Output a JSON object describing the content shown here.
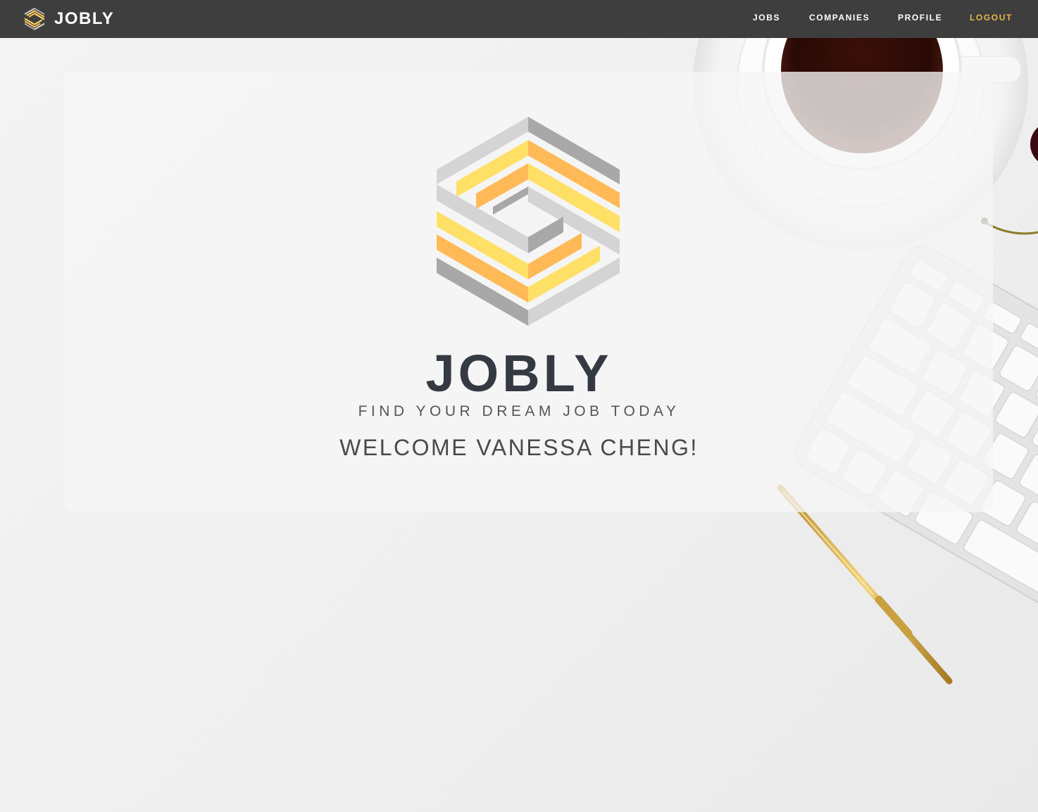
{
  "navbar": {
    "brand": "JOBLY",
    "links": {
      "jobs": "JOBS",
      "companies": "COMPANIES",
      "profile": "PROFILE",
      "logout": "LOGOUT"
    }
  },
  "hero": {
    "title": "JOBLY",
    "tagline": "FIND YOUR DREAM JOB TODAY",
    "welcome": "WELCOME VANESSA CHENG!"
  },
  "icons": {
    "brand_logo": "jobly-hexagon-logo-icon",
    "hero_logo": "jobly-hexagon-logo-icon"
  },
  "colors": {
    "navbar_bg": "#3e3e3e",
    "logout_accent": "#e5b64b",
    "logo_gray_light": "#d4d4d4",
    "logo_gray_dark": "#a8a8a8",
    "logo_yellow": "#ffe066",
    "logo_orange": "#ffba57",
    "title_color": "#353942"
  }
}
